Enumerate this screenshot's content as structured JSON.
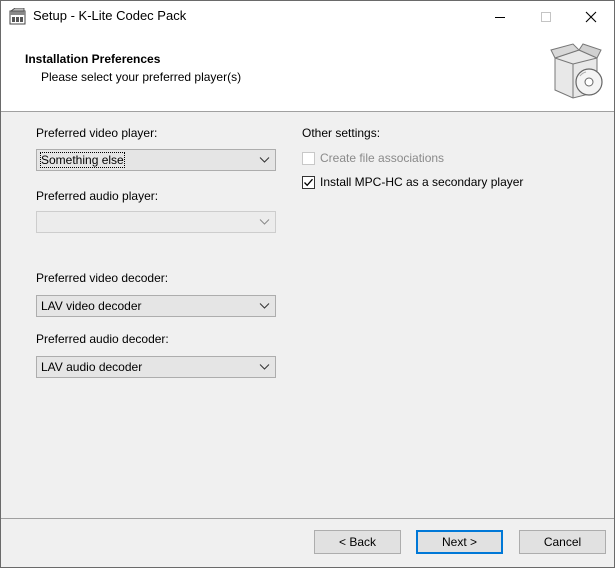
{
  "window": {
    "title": "Setup - K-Lite Codec Pack",
    "minimize_glyph": "–",
    "maximize_glyph": "□",
    "close_glyph": "✕"
  },
  "header": {
    "title": "Installation Preferences",
    "subtitle": "Please select your preferred player(s)"
  },
  "players": {
    "video_label": "Preferred video player:",
    "video_value": "Something else",
    "audio_label": "Preferred audio player:",
    "audio_value": ""
  },
  "decoders": {
    "video_label": "Preferred video decoder:",
    "video_value": "LAV video decoder",
    "audio_label": "Preferred audio decoder:",
    "audio_value": "LAV audio decoder"
  },
  "other": {
    "label": "Other settings:",
    "options": [
      {
        "label": "Create file associations",
        "checked": false,
        "enabled": false
      },
      {
        "label": "Install MPC-HC as a secondary player",
        "checked": true,
        "enabled": true
      }
    ]
  },
  "buttons": {
    "back": "< Back",
    "next": "Next >",
    "cancel": "Cancel"
  }
}
